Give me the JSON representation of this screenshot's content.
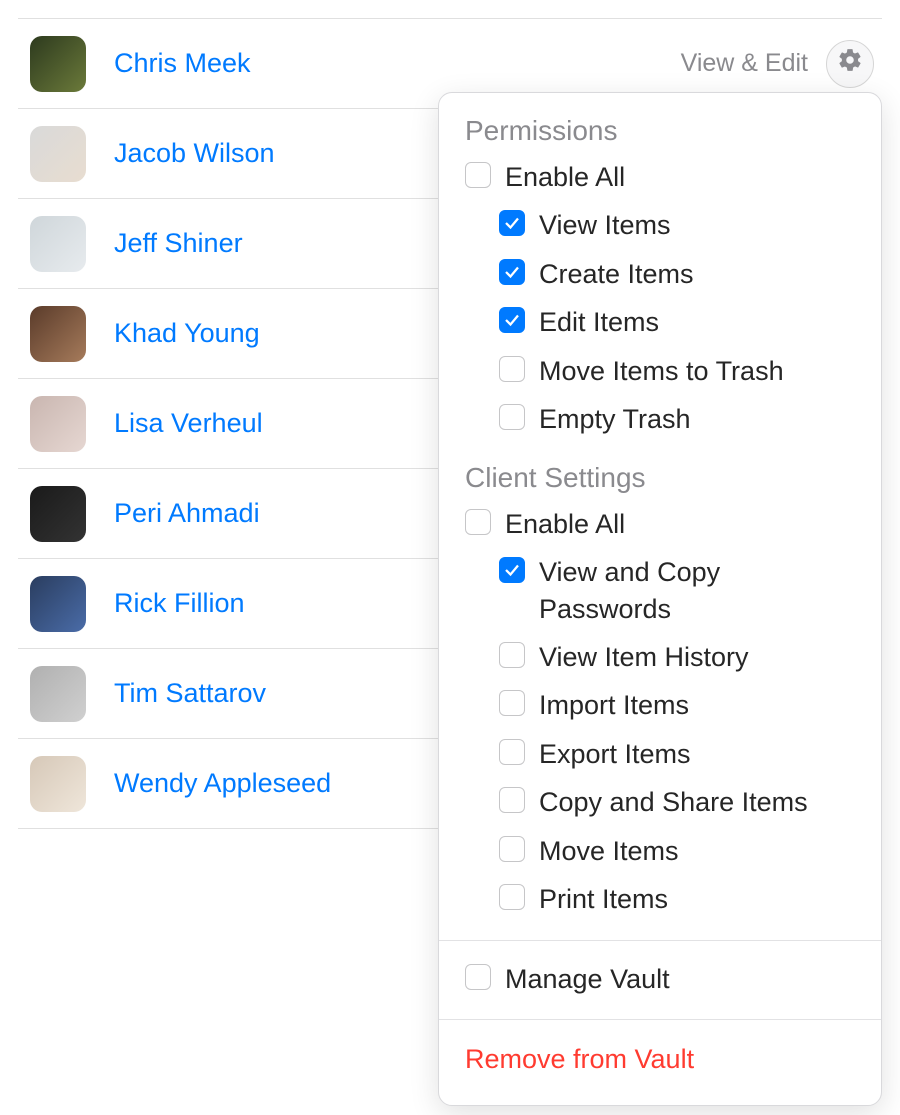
{
  "users": [
    {
      "name": "Chris Meek",
      "role": "View & Edit",
      "show_role": true,
      "show_gear": true
    },
    {
      "name": "Jacob Wilson",
      "role": "",
      "show_role": false,
      "show_gear": false
    },
    {
      "name": "Jeff Shiner",
      "role": "",
      "show_role": false,
      "show_gear": false
    },
    {
      "name": "Khad Young",
      "role": "",
      "show_role": false,
      "show_gear": false
    },
    {
      "name": "Lisa Verheul",
      "role": "",
      "show_role": false,
      "show_gear": false
    },
    {
      "name": "Peri Ahmadi",
      "role": "",
      "show_role": false,
      "show_gear": false
    },
    {
      "name": "Rick Fillion",
      "role": "",
      "show_role": false,
      "show_gear": false
    },
    {
      "name": "Tim Sattarov",
      "role": "",
      "show_role": false,
      "show_gear": false
    },
    {
      "name": "Wendy Appleseed",
      "role": "",
      "show_role": false,
      "show_gear": false
    }
  ],
  "popover": {
    "permissions_heading": "Permissions",
    "permissions_enable_all": "Enable All",
    "permissions_items": [
      {
        "label": "View Items",
        "checked": true
      },
      {
        "label": "Create Items",
        "checked": true
      },
      {
        "label": "Edit Items",
        "checked": true
      },
      {
        "label": "Move Items to Trash",
        "checked": false
      },
      {
        "label": "Empty Trash",
        "checked": false
      }
    ],
    "client_heading": "Client Settings",
    "client_enable_all": "Enable All",
    "client_items": [
      {
        "label": "View and Copy Passwords",
        "checked": true
      },
      {
        "label": "View Item History",
        "checked": false
      },
      {
        "label": "Import Items",
        "checked": false
      },
      {
        "label": "Export Items",
        "checked": false
      },
      {
        "label": "Copy and Share Items",
        "checked": false
      },
      {
        "label": "Move Items",
        "checked": false
      },
      {
        "label": "Print Items",
        "checked": false
      }
    ],
    "manage_vault": {
      "label": "Manage Vault",
      "checked": false
    },
    "remove_label": "Remove from Vault"
  }
}
